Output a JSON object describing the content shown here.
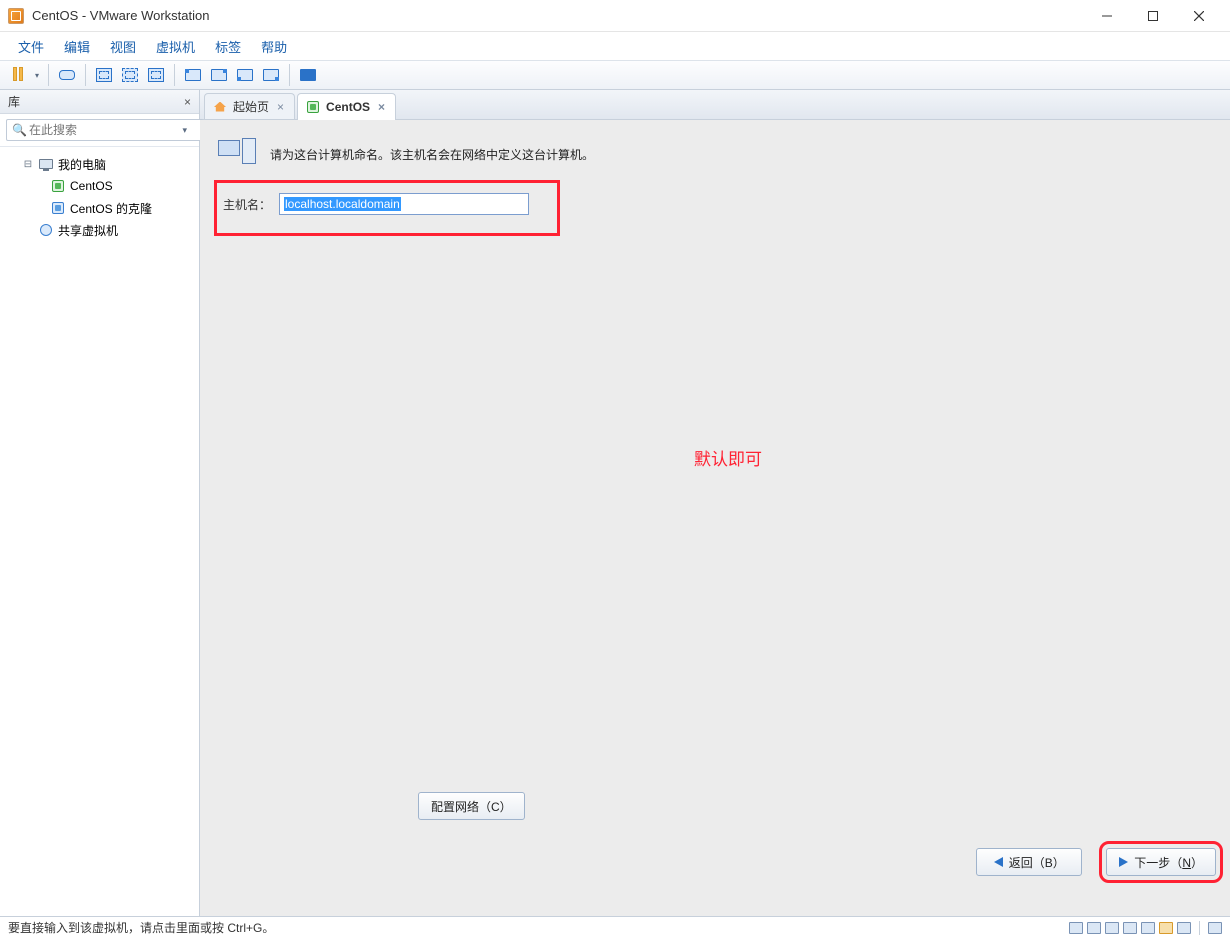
{
  "window": {
    "title": "CentOS - VMware Workstation"
  },
  "menus": [
    "文件",
    "编辑",
    "视图",
    "虚拟机",
    "标签",
    "帮助"
  ],
  "sidebar": {
    "title": "库",
    "search_placeholder": "在此搜索",
    "root": "我的电脑",
    "items": [
      "CentOS",
      "CentOS 的克隆"
    ],
    "shared": "共享虚拟机"
  },
  "tabs": {
    "home": "起始页",
    "active": "CentOS"
  },
  "content": {
    "instruction": "请为这台计算机命名。该主机名会在网络中定义这台计算机。",
    "hostname_label": "主机名：",
    "hostname_value": "localhost.localdomain",
    "annotation": "默认即可",
    "configure_network": "配置网络（C）",
    "back": "返回（B）",
    "next_prefix": "下一步（",
    "next_key": "N",
    "next_suffix": "）"
  },
  "statusbar": {
    "hint": "要直接输入到该虚拟机，请点击里面或按 Ctrl+G。"
  }
}
